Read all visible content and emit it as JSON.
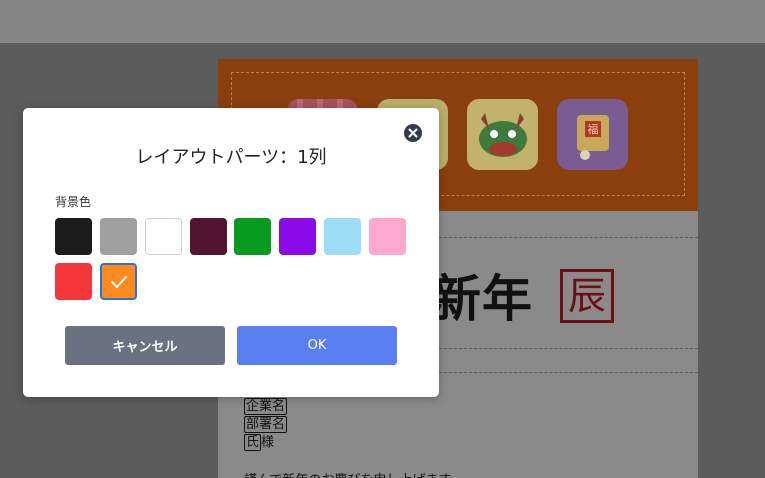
{
  "modal": {
    "title": "レイアウトパーツ：1列",
    "background_label": "背景色",
    "cancel_label": "キャンセル",
    "ok_label": "OK",
    "selected_color": "#ff8a20",
    "colors": [
      "#1c1c1c",
      "#a0a0a0",
      "#ffffff",
      "#541530",
      "#069a1e",
      "#8a0be8",
      "#9cdcf5",
      "#ffa8cf",
      "#f5363b",
      "#ff8a20"
    ]
  },
  "canvas": {
    "banner_color": "#8b3f0d",
    "title_text": "新年",
    "title_badge": "辰",
    "tile_badge_text": "福",
    "merge_fields": {
      "company": "企業名",
      "department": "部署名",
      "surname": "氏",
      "honorific": "様"
    },
    "greeting": "謹んで新年のお慶びを申し上げます"
  }
}
